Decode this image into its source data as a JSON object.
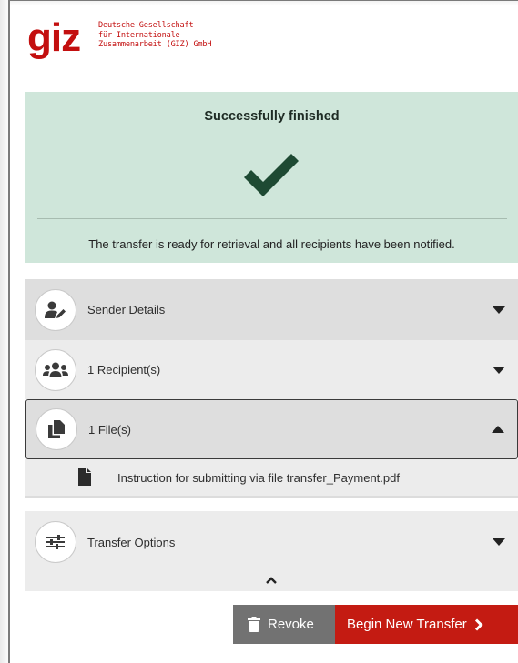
{
  "logo": {
    "mark": "giz",
    "lines": [
      "Deutsche Gesellschaft",
      "für Internationale",
      "Zusammenarbeit (GIZ) GmbH"
    ],
    "color": "#c30f0f"
  },
  "success": {
    "title": "Successfully finished",
    "icon": "checkmark-icon",
    "message": "The transfer is ready for retrieval and all recipients have been notified.",
    "bg_color": "#cfe6da",
    "check_color": "#1e4a33"
  },
  "accordion": {
    "sender": {
      "label": "Sender Details",
      "icon": "user-edit-icon",
      "expanded": false
    },
    "recipients": {
      "label": "1 Recipient(s)",
      "icon": "users-icon",
      "expanded": false
    },
    "files": {
      "label": "1 File(s)",
      "icon": "copy-files-icon",
      "expanded": true,
      "items": [
        {
          "name": "Instruction for submitting via file transfer_Payment.pdf",
          "icon": "file-icon"
        }
      ]
    },
    "options": {
      "label": "Transfer Options",
      "icon": "sliders-icon",
      "expanded": false
    },
    "collapse_icon": "chevron-up-icon"
  },
  "actions": {
    "revoke": {
      "label": "Revoke",
      "icon": "trash-icon",
      "color": "#727272"
    },
    "begin": {
      "label": "Begin New Transfer",
      "icon": "chevron-right-icon",
      "color": "#c41b12"
    }
  }
}
